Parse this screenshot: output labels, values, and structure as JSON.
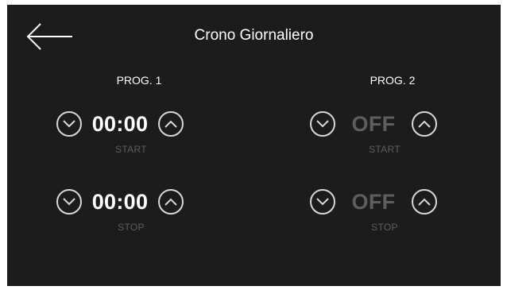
{
  "header": {
    "title": "Crono Giornaliero",
    "back_icon": "arrow-left-icon"
  },
  "programs": [
    {
      "label": "PROG. 1",
      "start": {
        "value": "00:00",
        "label": "START",
        "active": true
      },
      "stop": {
        "value": "00:00",
        "label": "STOP",
        "active": true
      }
    },
    {
      "label": "PROG. 2",
      "start": {
        "value": "OFF",
        "label": "START",
        "active": false
      },
      "stop": {
        "value": "OFF",
        "label": "STOP",
        "active": false
      }
    }
  ],
  "colors": {
    "background": "#1c1c1c",
    "text_active": "#ffffff",
    "text_inactive": "#5e5e5e",
    "button_border": "#d8d8d8"
  }
}
